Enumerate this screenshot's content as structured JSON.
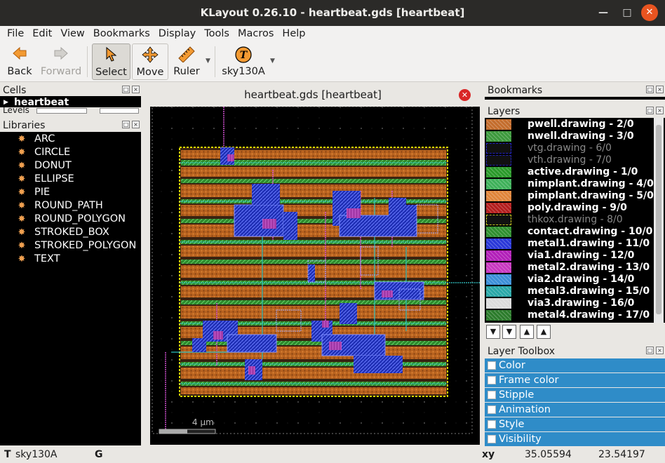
{
  "window": {
    "title": "KLayout 0.26.10 - heartbeat.gds [heartbeat]",
    "min_icon": "minimize-icon",
    "max_icon": "maximize-icon",
    "close_icon": "close-icon"
  },
  "menu": [
    "File",
    "Edit",
    "View",
    "Bookmarks",
    "Display",
    "Tools",
    "Macros",
    "Help"
  ],
  "toolbar": {
    "back": "Back",
    "forward": "Forward",
    "select": "Select",
    "move": "Move",
    "ruler": "Ruler",
    "tech": "sky130A",
    "tech_glyph": "T"
  },
  "cells": {
    "title": "Cells",
    "top_cell": "heartbeat",
    "levels_label": "Levels"
  },
  "libraries": {
    "title": "Libraries",
    "items": [
      "ARC",
      "CIRCLE",
      "DONUT",
      "ELLIPSE",
      "PIE",
      "ROUND_PATH",
      "ROUND_POLYGON",
      "STROKED_BOX",
      "STROKED_POLYGON",
      "TEXT"
    ]
  },
  "view": {
    "tab_title": "heartbeat.gds [heartbeat]",
    "scale_label": "4  µm"
  },
  "bookmarks": {
    "title": "Bookmarks"
  },
  "layers": {
    "title": "Layers",
    "items": [
      {
        "name": "pwell.drawing - 2/0",
        "color": "#c46d2d",
        "dim": false
      },
      {
        "name": "nwell.drawing - 3/0",
        "color": "#3d9a3d",
        "dim": false
      },
      {
        "name": "vtg.drawing - 6/0",
        "color": "#2222cc",
        "dim": true
      },
      {
        "name": "vth.drawing - 7/0",
        "color": "#2222aa",
        "dim": true
      },
      {
        "name": "active.drawing - 1/0",
        "color": "#2a9a2a",
        "dim": false
      },
      {
        "name": "nimplant.drawing - 4/0",
        "color": "#3fb15a",
        "dim": false
      },
      {
        "name": "pimplant.drawing - 5/0",
        "color": "#e0853a",
        "dim": false
      },
      {
        "name": "poly.drawing - 9/0",
        "color": "#b41e1e",
        "dim": false
      },
      {
        "name": "thkox.drawing - 8/0",
        "color": "#c8c81e",
        "dim": true
      },
      {
        "name": "contact.drawing - 10/0",
        "color": "#2f8f2f",
        "dim": false
      },
      {
        "name": "metal1.drawing - 11/0",
        "color": "#2a38d8",
        "dim": false
      },
      {
        "name": "via1.drawing - 12/0",
        "color": "#b21fb8",
        "dim": false
      },
      {
        "name": "metal2.drawing - 13/0",
        "color": "#c838c0",
        "dim": false
      },
      {
        "name": "via2.drawing - 14/0",
        "color": "#3c8fd8",
        "dim": false
      },
      {
        "name": "metal3.drawing - 15/0",
        "color": "#2aa8a8",
        "dim": false
      },
      {
        "name": "via3.drawing - 16/0",
        "color": "#dcdcdc",
        "dim": false
      },
      {
        "name": "metal4.drawing - 17/0",
        "color": "#2c7c2c",
        "dim": false
      }
    ]
  },
  "toolbox": {
    "title": "Layer Toolbox",
    "items": [
      "Color",
      "Frame color",
      "Stipple",
      "Animation",
      "Style",
      "Visibility"
    ]
  },
  "status": {
    "tech_marker": "T",
    "tech": "sky130A",
    "grid": "G",
    "xy_label": "xy",
    "x": "35.05594",
    "y": "23.54197"
  }
}
